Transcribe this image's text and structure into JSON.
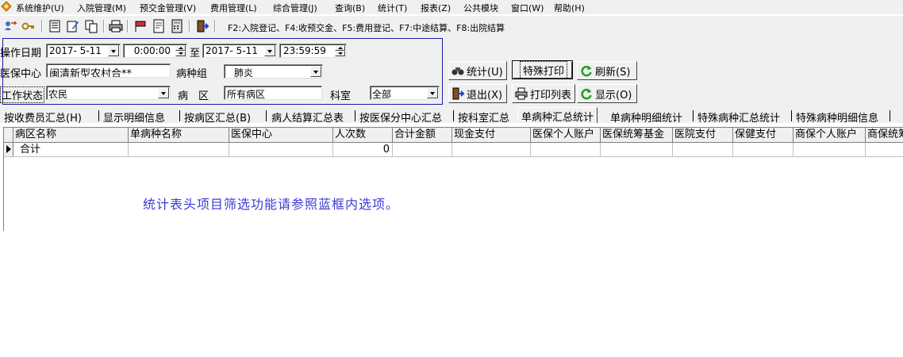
{
  "menu": [
    "系统维护(U)",
    "入院管理(M)",
    "预交金管理(V)",
    "费用管理(L)",
    "综合管理(J)",
    "查询(B)",
    "统计(T)",
    "报表(Z)",
    "公共模块",
    "窗口(W)",
    "帮助(H)"
  ],
  "toolbar": {
    "hotkeys": "F2:入院登记、F4:收预交金、F5:费用登记、F7:中途结算、F8:出院结算"
  },
  "filters": {
    "op_date_label": "操作日期",
    "date_from": "2017- 5-11",
    "time_from": "0:00:00",
    "to_label": "至",
    "date_to": "2017- 5-11",
    "time_to": "23:59:59",
    "insurance_center_label": "医保中心",
    "insurance_center_value": "闽清新型农村合**",
    "disease_group_label": "病种组",
    "disease_group_value": "肺炎",
    "work_status_label": "工作状态",
    "work_status_value": "农民",
    "ward_label": "病　区",
    "ward_value": "所有病区",
    "dept_label": "科室",
    "dept_value": "全部"
  },
  "buttons": {
    "stats": "统计(U)",
    "special_print": "特殊打印",
    "refresh": "刷新(S)",
    "exit": "退出(X)",
    "print_list": "打印列表",
    "display": "显示(O)"
  },
  "tabs": [
    "按收费员汇总(H)",
    "显示明细信息",
    "按病区汇总(B)",
    "病人结算汇总表",
    "按医保分中心汇总",
    "按科室汇总",
    "单病种汇总统计",
    "单病种明细统计",
    "特殊病种汇总统计",
    "特殊病种明细信息"
  ],
  "active_tab": "单病种汇总统计",
  "table": {
    "columns": [
      "病区名称",
      "单病种名称",
      "医保中心",
      "人次数",
      "合计金额",
      "现金支付",
      "医保个人账户",
      "医保统筹基金",
      "医院支付",
      "保健支付",
      "商保个人账户",
      "商保统筹"
    ],
    "rows": [
      {
        "ward": "合计",
        "visits": "0"
      }
    ]
  },
  "hint": "统计表头项目筛选功能请参照蓝框内选项。",
  "colors": {
    "accent_blue": "#1a1aa8",
    "hint_text": "#3a3ad4",
    "face": "#f0f0f0"
  }
}
